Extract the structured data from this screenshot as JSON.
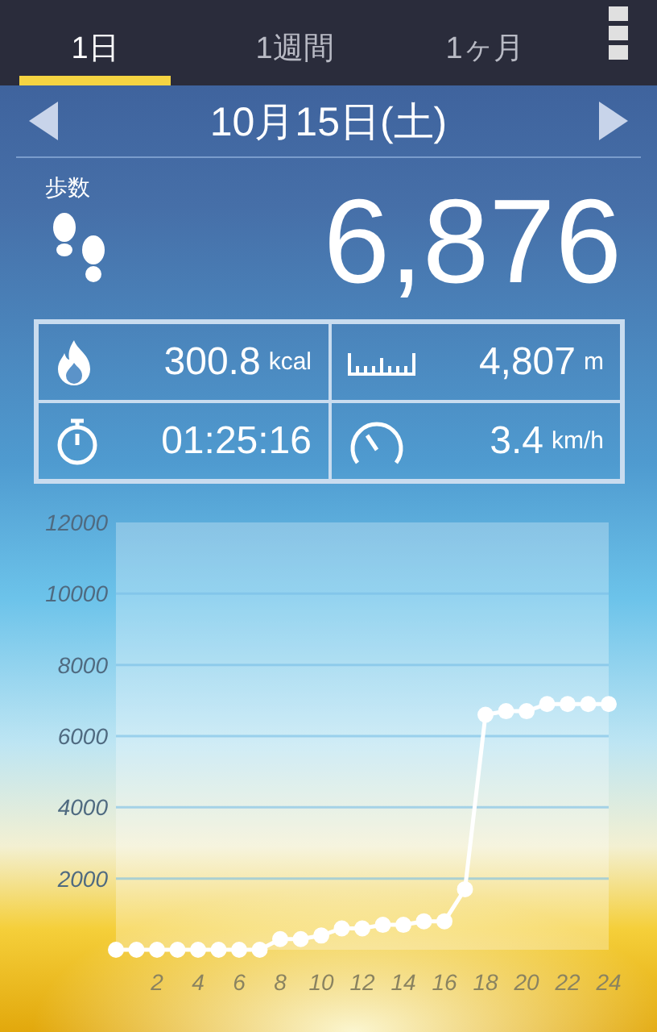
{
  "tabs": [
    {
      "label": "1日",
      "selected": true
    },
    {
      "label": "1週間",
      "selected": false
    },
    {
      "label": "1ヶ月",
      "selected": false
    }
  ],
  "date": "10月15日(土)",
  "steps": {
    "label": "歩数",
    "value": "6,876"
  },
  "stats": [
    {
      "kind": "calories",
      "value": "300.8",
      "unit": "kcal"
    },
    {
      "kind": "distance",
      "value": "4,807",
      "unit": "m"
    },
    {
      "kind": "time",
      "value": "01:25:16"
    },
    {
      "kind": "speed",
      "value": "3.4",
      "unit": "km/h"
    }
  ],
  "chart": {
    "chart_data": {
      "type": "line",
      "x": [
        0,
        1,
        2,
        3,
        4,
        5,
        6,
        7,
        8,
        9,
        10,
        11,
        12,
        13,
        14,
        15,
        16,
        17,
        18,
        19,
        20,
        21,
        22,
        23,
        24
      ],
      "series": [
        {
          "color": "#ffffff",
          "marker": true,
          "values": [
            0,
            0,
            0,
            0,
            0,
            0,
            0,
            0,
            300,
            300,
            400,
            600,
            600,
            700,
            700,
            800,
            800,
            1700,
            6600,
            6700,
            6700,
            6900,
            6900,
            6900,
            6900
          ]
        }
      ],
      "grid": true,
      "xlim": [
        0,
        24
      ],
      "ylim": [
        0,
        12000
      ],
      "xticks": [
        2,
        4,
        6,
        8,
        10,
        12,
        14,
        16,
        18,
        20,
        22,
        24
      ],
      "yticks": [
        2000,
        4000,
        6000,
        8000,
        10000,
        12000
      ]
    }
  }
}
